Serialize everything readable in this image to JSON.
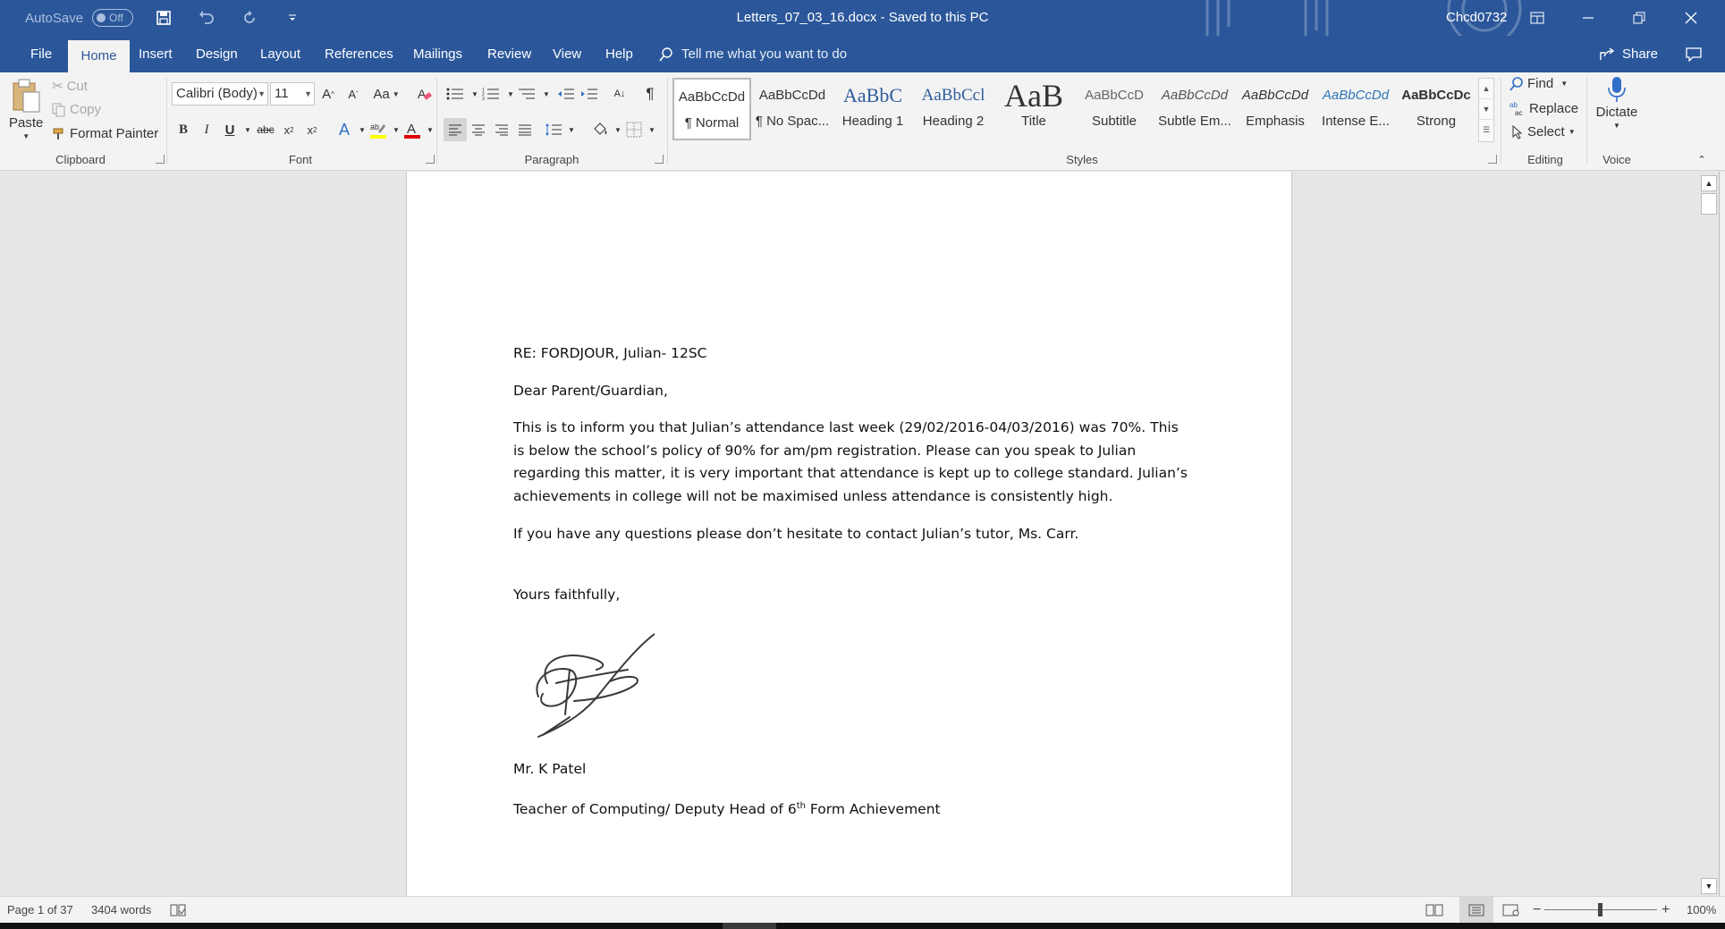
{
  "titlebar": {
    "autosave_label": "AutoSave",
    "autosave_state": "Off",
    "doc_title": "Letters_07_03_16.docx  -  Saved to this PC",
    "user": "Chcd0732",
    "icons": [
      "save-icon",
      "undo-icon",
      "redo-icon",
      "customize-qat-icon",
      "ribbon-display-icon",
      "minimize-icon",
      "restore-icon",
      "close-icon"
    ]
  },
  "tabs": {
    "file": "File",
    "home": "Home",
    "insert": "Insert",
    "design": "Design",
    "layout": "Layout",
    "references": "References",
    "mailings": "Mailings",
    "review": "Review",
    "view": "View",
    "help": "Help",
    "tell_me": "Tell me what you want to do",
    "share": "Share"
  },
  "ribbon": {
    "clipboard": {
      "label": "Clipboard",
      "paste": "Paste",
      "cut": "Cut",
      "copy": "Copy",
      "format_painter": "Format Painter"
    },
    "font": {
      "label": "Font",
      "font_name": "Calibri (Body)",
      "font_size": "11",
      "change_case": "Aa"
    },
    "paragraph": {
      "label": "Paragraph"
    },
    "styles": {
      "label": "Styles",
      "items": [
        {
          "preview": "AaBbCcDd",
          "name": "¶ Normal"
        },
        {
          "preview": "AaBbCcDd",
          "name": "¶ No Spac..."
        },
        {
          "preview": "AaBbC",
          "name": "Heading 1"
        },
        {
          "preview": "AaBbCcl",
          "name": "Heading 2"
        },
        {
          "preview": "AaB",
          "name": "Title"
        },
        {
          "preview": "AaBbCcD",
          "name": "Subtitle"
        },
        {
          "preview": "AaBbCcDd",
          "name": "Subtle Em..."
        },
        {
          "preview": "AaBbCcDd",
          "name": "Emphasis"
        },
        {
          "preview": "AaBbCcDd",
          "name": "Intense E..."
        },
        {
          "preview": "AaBbCcDc",
          "name": "Strong"
        }
      ]
    },
    "editing": {
      "label": "Editing",
      "find": "Find",
      "replace": "Replace",
      "select": "Select"
    },
    "voice": {
      "label": "Voice",
      "dictate": "Dictate"
    }
  },
  "document": {
    "re_line": "RE:  FORDJOUR, Julian- 12SC",
    "greeting": "Dear Parent/Guardian,",
    "body1": "This is to inform you that Julian’s attendance last week (29/02/2016-04/03/2016) was 70%. This is below the school’s policy of 90% for am/pm registration. Please can you speak to Julian regarding this matter, it is very important that attendance is kept up to college standard. Julian’s achievements in college will not be maximised unless attendance is consistently high.",
    "body2": "If you have any questions please don’t hesitate to contact Julian’s tutor, Ms. Carr.",
    "closing": "Yours faithfully,",
    "signer": "Mr. K Patel",
    "role_prefix": "Teacher of Computing/ Deputy Head of 6",
    "role_sup": "th",
    "role_suffix": " Form Achievement"
  },
  "statusbar": {
    "page": "Page 1 of 37",
    "words": "3404 words",
    "zoom": "100%",
    "zoom_minus": "−",
    "zoom_plus": "+"
  },
  "colors": {
    "accent": "#2b579a",
    "ribbon_bg": "#f3f3f3",
    "canvas_bg": "#e6e6e6"
  }
}
